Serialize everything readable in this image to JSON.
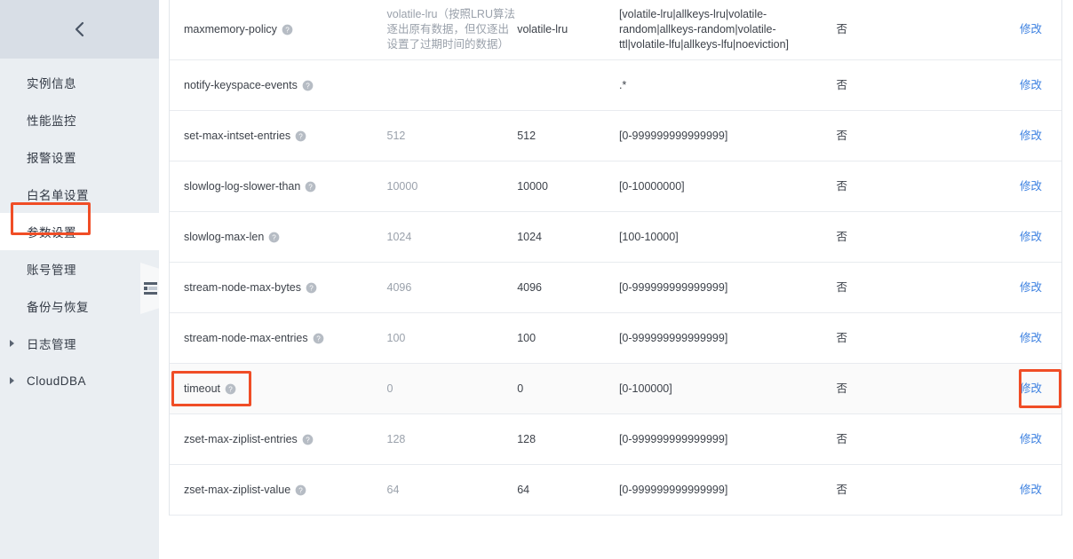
{
  "sidebar": {
    "collapse_chevron_icon": "chevron-left-icon",
    "panel_handle_icon": "panel-list-icon",
    "items": [
      {
        "label": "实例信息",
        "selected": false,
        "expandable": false
      },
      {
        "label": "性能监控",
        "selected": false,
        "expandable": false
      },
      {
        "label": "报警设置",
        "selected": false,
        "expandable": false
      },
      {
        "label": "白名单设置",
        "selected": false,
        "expandable": false
      },
      {
        "label": "参数设置",
        "selected": true,
        "expandable": false
      },
      {
        "label": "账号管理",
        "selected": false,
        "expandable": false
      },
      {
        "label": "备份与恢复",
        "selected": false,
        "expandable": false
      },
      {
        "label": "日志管理",
        "selected": false,
        "expandable": true
      },
      {
        "label": "CloudDBA",
        "selected": false,
        "expandable": true
      }
    ]
  },
  "table": {
    "action_label": "修改",
    "help_icon": "help-circle-icon",
    "rows": [
      {
        "name": "maxmemory-policy",
        "default": "volatile-lru（按照LRU算法逐出原有数据，但仅逐出设置了过期时间的数据）",
        "current": "volatile-lru",
        "range": "[volatile-lru|allkeys-lru|volatile-random|allkeys-random|volatile-ttl|volatile-lfu|allkeys-lfu|noeviction]",
        "restart": "否",
        "highlight": false
      },
      {
        "name": "notify-keyspace-events",
        "default": "",
        "current": "",
        "range": ".*",
        "restart": "否",
        "highlight": false
      },
      {
        "name": "set-max-intset-entries",
        "default": "512",
        "current": "512",
        "range": "[0-999999999999999]",
        "restart": "否",
        "highlight": false
      },
      {
        "name": "slowlog-log-slower-than",
        "default": "10000",
        "current": "10000",
        "range": "[0-10000000]",
        "restart": "否",
        "highlight": false
      },
      {
        "name": "slowlog-max-len",
        "default": "1024",
        "current": "1024",
        "range": "[100-10000]",
        "restart": "否",
        "highlight": false
      },
      {
        "name": "stream-node-max-bytes",
        "default": "4096",
        "current": "4096",
        "range": "[0-999999999999999]",
        "restart": "否",
        "highlight": false
      },
      {
        "name": "stream-node-max-entries",
        "default": "100",
        "current": "100",
        "range": "[0-999999999999999]",
        "restart": "否",
        "highlight": false
      },
      {
        "name": "timeout",
        "default": "0",
        "current": "0",
        "range": "[0-100000]",
        "restart": "否",
        "highlight": true
      },
      {
        "name": "zset-max-ziplist-entries",
        "default": "128",
        "current": "128",
        "range": "[0-999999999999999]",
        "restart": "否",
        "highlight": false
      },
      {
        "name": "zset-max-ziplist-value",
        "default": "64",
        "current": "64",
        "range": "[0-999999999999999]",
        "restart": "否",
        "highlight": false
      }
    ]
  },
  "colors": {
    "annotation": "#f04d26",
    "link": "#3a7fe0",
    "sidebar_bg": "#eaeef2",
    "sidebar_header_bg": "#d8dee6"
  }
}
